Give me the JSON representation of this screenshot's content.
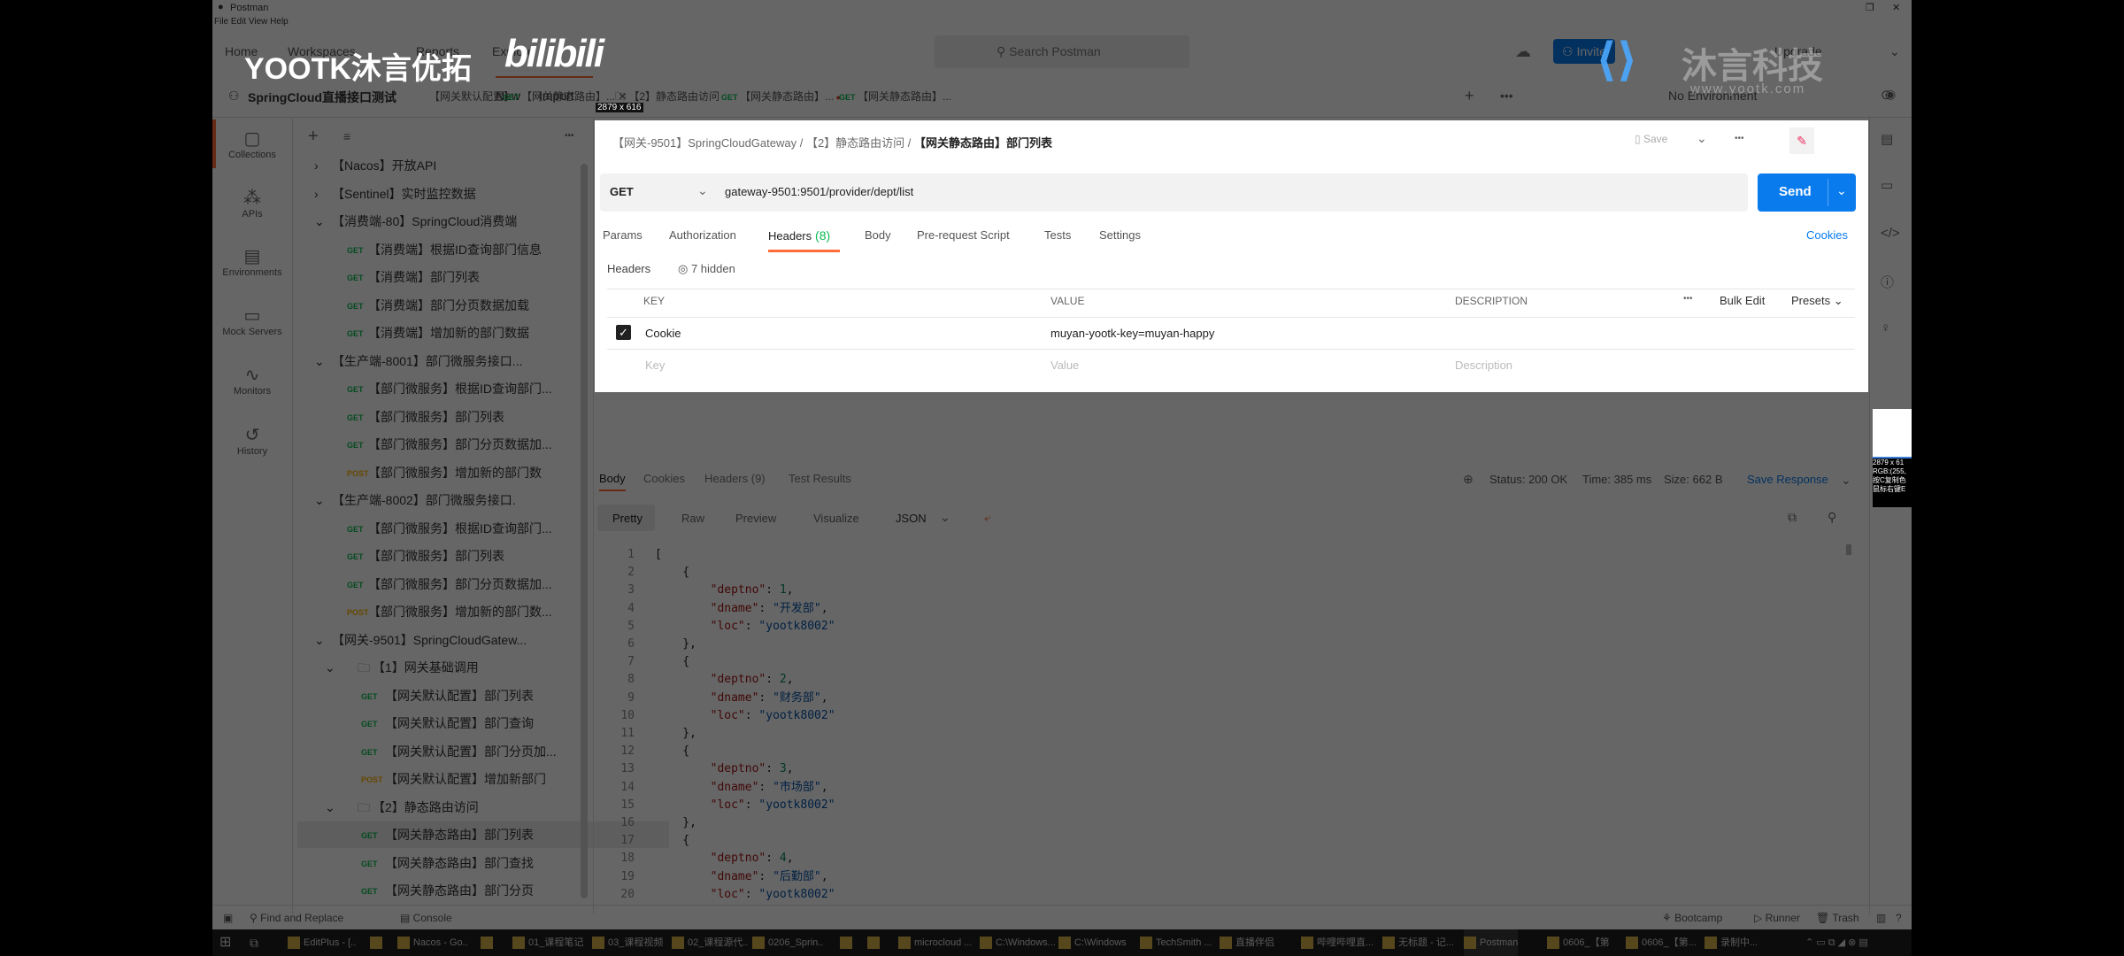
{
  "app": {
    "title": "Postman",
    "menu": [
      "File",
      "Edit",
      "View",
      "Help"
    ]
  },
  "nav": {
    "items": [
      "Home",
      "Workspaces",
      "Reports",
      "Explore"
    ],
    "search_placeholder": "Search Postman",
    "invite": "Invite",
    "upgrade": "Upgrade"
  },
  "workspace": {
    "name": "SpringCloud直播接口测试",
    "new": "New",
    "import": "Import"
  },
  "tabs": [
    {
      "method": "",
      "label": "【网关默认配置】"
    },
    {
      "method": "GET",
      "label": "【网关静态路由】...",
      "active": true
    },
    {
      "method": "",
      "label": "【2】静态路由访问",
      "folder": true
    },
    {
      "method": "GET",
      "label": "【网关静态路由】...",
      "unsaved": true
    },
    {
      "method": "GET",
      "label": "【网关静态路由】..."
    }
  ],
  "environment": "No Environment",
  "sidebar": {
    "items": [
      "Collections",
      "APIs",
      "Environments",
      "Mock Servers",
      "Monitors",
      "History"
    ]
  },
  "tree": [
    {
      "kind": "collection",
      "label": "【Nacos】开放API",
      "open": false
    },
    {
      "kind": "collection",
      "label": "【Sentinel】实时监控数据",
      "open": false
    },
    {
      "kind": "collection",
      "label": "【消费端-80】SpringCloud消费端",
      "open": true
    },
    {
      "kind": "req",
      "method": "GET",
      "label": "【消费端】根据ID查询部门信息"
    },
    {
      "kind": "req",
      "method": "GET",
      "label": "【消费端】部门列表"
    },
    {
      "kind": "req",
      "method": "GET",
      "label": "【消费端】部门分页数据加载"
    },
    {
      "kind": "req",
      "method": "GET",
      "label": "【消费端】增加新的部门数据"
    },
    {
      "kind": "collection",
      "label": "【生产端-8001】部门微服务接口...",
      "open": true
    },
    {
      "kind": "req",
      "method": "GET",
      "label": "【部门微服务】根据ID查询部门..."
    },
    {
      "kind": "req",
      "method": "GET",
      "label": "【部门微服务】部门列表"
    },
    {
      "kind": "req",
      "method": "GET",
      "label": "【部门微服务】部门分页数据加..."
    },
    {
      "kind": "req",
      "method": "POST",
      "label": "【部门微服务】增加新的部门数"
    },
    {
      "kind": "collection",
      "label": "【生产端-8002】部门微服务接口.",
      "open": true
    },
    {
      "kind": "req",
      "method": "GET",
      "label": "【部门微服务】根据ID查询部门..."
    },
    {
      "kind": "req",
      "method": "GET",
      "label": "【部门微服务】部门列表"
    },
    {
      "kind": "req",
      "method": "GET",
      "label": "【部门微服务】部门分页数据加..."
    },
    {
      "kind": "req",
      "method": "POST",
      "label": "【部门微服务】增加新的部门数..."
    },
    {
      "kind": "collection",
      "label": "【网关-9501】SpringCloudGatew...",
      "open": true
    },
    {
      "kind": "folder",
      "label": "【1】网关基础调用",
      "open": true
    },
    {
      "kind": "subreq",
      "method": "GET",
      "label": "【网关默认配置】部门列表"
    },
    {
      "kind": "subreq",
      "method": "GET",
      "label": "【网关默认配置】部门查询"
    },
    {
      "kind": "subreq",
      "method": "GET",
      "label": "【网关默认配置】部门分页加..."
    },
    {
      "kind": "subreq",
      "method": "POST",
      "label": "【网关默认配置】增加新部门"
    },
    {
      "kind": "folder",
      "label": "【2】静态路由访问",
      "open": true
    },
    {
      "kind": "subreq",
      "method": "GET",
      "label": "【网关静态路由】部门列表",
      "selected": true
    },
    {
      "kind": "subreq",
      "method": "GET",
      "label": "【网关静态路由】部门查找"
    },
    {
      "kind": "subreq",
      "method": "GET",
      "label": "【网关静态路由】部门分页"
    }
  ],
  "request": {
    "breadcrumb": [
      "【网关-9501】SpringCloudGateway",
      "【2】静态路由访问",
      "【网关静态路由】部门列表"
    ],
    "save": "Save",
    "method": "GET",
    "url": "gateway-9501:9501/provider/dept/list",
    "send": "Send",
    "tabs": [
      "Params",
      "Authorization",
      "Headers",
      "Body",
      "Pre-request Script",
      "Tests",
      "Settings"
    ],
    "headers_count": "(8)",
    "active_tab": "Headers",
    "cookies_link": "Cookies",
    "headers_label": "Headers",
    "hidden": "7 hidden",
    "columns": {
      "key": "KEY",
      "value": "VALUE",
      "description": "DESCRIPTION"
    },
    "bulk_edit": "Bulk Edit",
    "presets": "Presets",
    "rows": [
      {
        "checked": true,
        "key": "Cookie",
        "value": "muyan-yootk-key=muyan-happy",
        "description": ""
      }
    ],
    "placeholders": {
      "key": "Key",
      "value": "Value",
      "description": "Description"
    }
  },
  "response": {
    "tabs": [
      "Body",
      "Cookies",
      "Headers",
      "Test Results"
    ],
    "headers_count": "(9)",
    "status": "Status: 200 OK",
    "time": "Time: 385 ms",
    "size": "Size: 662 B",
    "save": "Save Response",
    "views": [
      "Pretty",
      "Raw",
      "Preview",
      "Visualize"
    ],
    "format": "JSON",
    "lines": [
      "[",
      "    {",
      "        \"deptno\": 1,",
      "        \"dname\": \"开发部\",",
      "        \"loc\": \"yootk8002\"",
      "    },",
      "    {",
      "        \"deptno\": 2,",
      "        \"dname\": \"财务部\",",
      "        \"loc\": \"yootk8002\"",
      "    },",
      "    {",
      "        \"deptno\": 3,",
      "        \"dname\": \"市场部\",",
      "        \"loc\": \"yootk8002\"",
      "    },",
      "    {",
      "        \"deptno\": 4,",
      "        \"dname\": \"后勤部\",",
      "        \"loc\": \"yootk8002\""
    ]
  },
  "statusbar": {
    "find": "Find and Replace",
    "console": "Console",
    "bootcamp": "Bootcamp",
    "runner": "Runner",
    "trash": "Trash"
  },
  "taskbar": [
    "EditPlus - [..",
    "",
    "Nacos - Go..",
    "",
    "01_课程笔记",
    "03_课程视频",
    "02_课程源代..",
    "0206_Sprin..",
    "",
    "",
    "microcloud ...",
    "C:\\Windows...",
    "C:\\Windows",
    "TechSmith ...",
    "直播伴侣",
    "哔哩哔哩直...",
    "无标题 - 记...",
    "Postman",
    "0606_【第",
    "0606_【第...",
    "录制中..."
  ],
  "overlay": {
    "size_label": "2879 x 616",
    "magnifier": [
      "2879 x 61",
      "RGB:(255,",
      "按C复制色",
      "鼠标右键E"
    ]
  },
  "watermark": {
    "left": "YOOTK沐言优拓",
    "bili": "bilibili",
    "right": "沐言科技",
    "url": "www.yootk.com"
  },
  "colors": {
    "accent": "#ff6c37",
    "send": "#097bed",
    "get": "#0cbb52",
    "post": "#ffb400"
  }
}
